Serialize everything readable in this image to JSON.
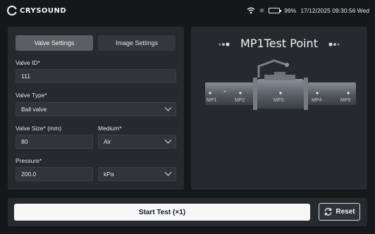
{
  "header": {
    "brand": "CRYSOUND",
    "battery": "99%",
    "battery_level": 0.99,
    "datetime": "17/12/2025 09:30:56 Wed",
    "icons": [
      "wifi-icon",
      "bluetooth-icon",
      "battery-icon"
    ]
  },
  "tabs": [
    {
      "label": "Valve Settings",
      "active": true
    },
    {
      "label": "Image Settings",
      "active": false
    }
  ],
  "form": {
    "valve_id": {
      "label": "Valve ID*",
      "value": "111"
    },
    "valve_type": {
      "label": "Valve Type*",
      "value": "Ball valve"
    },
    "valve_size": {
      "label": "Valve Size* (mm)",
      "value": "80"
    },
    "medium": {
      "label": "Medium*",
      "value": "Air"
    },
    "pressure": {
      "label": "Pressure*",
      "value": "200.0",
      "unit": "kPa"
    }
  },
  "test_point": {
    "title": "MP1Test Point",
    "points": [
      "MP1",
      "MP2",
      "MP3",
      "MP4",
      "MP5"
    ]
  },
  "actions": {
    "start": "Start Test (×1)",
    "reset": "Reset"
  },
  "colors": {
    "background": "#15181b",
    "panel": "#262a2e",
    "input": "#31353a",
    "tab_active": "#5a5f64",
    "start_button": "#f7f7f7"
  }
}
